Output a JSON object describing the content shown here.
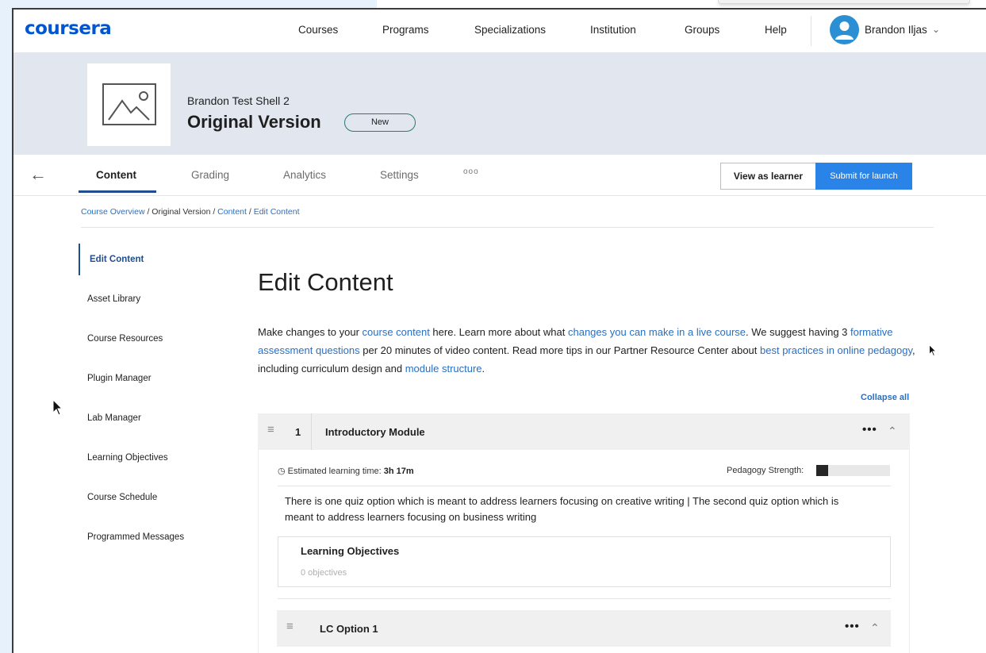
{
  "header": {
    "logo": "coursera",
    "nav": [
      "Courses",
      "Programs",
      "Specializations",
      "Institution",
      "Groups",
      "Help"
    ],
    "user_name": "Brandon Iljas",
    "user_chevron": "chevron-down-icon"
  },
  "hero": {
    "course_name": "Brandon Test Shell 2",
    "version_title": "Original Version",
    "badge": "New"
  },
  "tabs": {
    "items": [
      "Content",
      "Grading",
      "Analytics",
      "Settings"
    ],
    "active": "Content",
    "more": "ooo",
    "view_as_learner": "View as learner",
    "submit": "Submit for launch"
  },
  "breadcrumb": {
    "course_overview": "Course Overview",
    "sep1": " / Original Version / ",
    "content": "Content",
    "sep2": " / ",
    "edit_content": "Edit Content"
  },
  "sidebar": {
    "items": [
      "Edit Content",
      "Asset Library",
      "Course Resources",
      "Plugin Manager",
      "Lab Manager",
      "Learning Objectives",
      "Course Schedule",
      "Programmed Messages"
    ]
  },
  "main": {
    "title": "Edit Content",
    "desc": {
      "t1": "Make changes to your ",
      "l1": "course content",
      "t2": " here. Learn more about what ",
      "l2": "changes you can make in a live course",
      "t3": ". We suggest having 3 ",
      "l3": "formative assessment questions",
      "t4": " per 20 minutes of video content. Read more tips in our Partner Resource Center about ",
      "l4": "best practices in online pedagogy",
      "t5": ", including curriculum design and ",
      "l5": "module structure",
      "t6": "."
    },
    "collapse_all": "Collapse all"
  },
  "module": {
    "number": "1",
    "title": "Introductory Module",
    "est_label": "Estimated learning time: ",
    "est_value": "3h 17m",
    "pedagogy_label": "Pedagogy Strength:",
    "pedagogy_level": 0.16,
    "description": "There is one quiz option which is meant to address learners focusing on creative writing | The second quiz option which is meant to address learners focusing on business writing",
    "lo_title": "Learning Objectives",
    "lo_count": "0 objectives"
  },
  "lesson": {
    "title": "LC Option 1"
  },
  "colors": {
    "brand": "#0056d2",
    "primary_button": "#2a83e6",
    "link": "#2a6fc2",
    "active_tab": "#1f4d8f",
    "hero_bg": "#e1e6ef"
  }
}
